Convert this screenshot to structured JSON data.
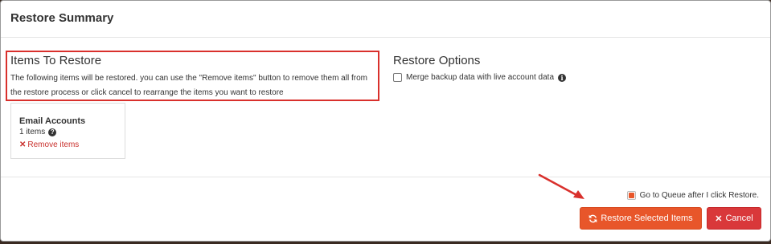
{
  "modal": {
    "title": "Restore Summary"
  },
  "items_to_restore": {
    "title": "Items To Restore",
    "description": "The following items will be restored. you can use the \"Remove items\" button to remove them all from the restore process or click cancel to rearrange the items you want to restore",
    "highlight_color": "#d9302c"
  },
  "card": {
    "title": "Email Accounts",
    "count": "1 items",
    "remove_label": "Remove items"
  },
  "restore_options": {
    "title": "Restore Options",
    "merge_label": "Merge backup data with live account data",
    "merge_checked": false
  },
  "footer": {
    "queue_label": "Go to Queue after I click Restore.",
    "queue_checked": true,
    "restore_button": "Restore Selected Items",
    "cancel_button": "Cancel"
  },
  "colors": {
    "accent": "#e8562a",
    "danger": "#d9383a"
  },
  "icons": {
    "help": "question-circle-icon",
    "info": "info-circle-icon",
    "remove": "times-icon",
    "restore": "refresh-icon",
    "cancel": "times-icon"
  }
}
